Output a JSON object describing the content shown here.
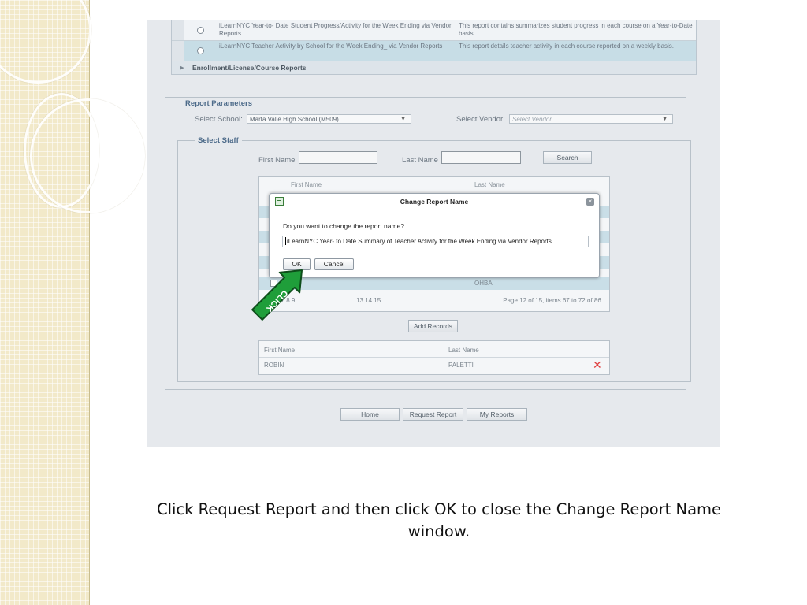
{
  "reports": {
    "rows": [
      {
        "name": "iLearnNYC Year-to- Date Student Progress/Activity for the Week Ending via Vendor Reports",
        "description": "This report contains summarizes student progress in each course on a Year-to-Date basis."
      },
      {
        "name": "iLearnNYC Teacher Activity by School for the Week Ending_ via Vendor Reports",
        "description": "This report details teacher activity in each course reported on a weekly basis."
      }
    ],
    "section": "Enrollment/License/Course Reports"
  },
  "params": {
    "legend": "Report Parameters",
    "school_label": "Select School:",
    "school_value": "Marta Valle High School (M509)",
    "vendor_label": "Select Vendor:",
    "vendor_placeholder": "Select Vendor"
  },
  "staff": {
    "legend": "Select Staff",
    "first_name_label": "First Name",
    "last_name_label": "Last Name",
    "search_label": "Search",
    "grid_first_header": "First Name",
    "grid_last_header": "Last Name",
    "last_row_first": "RO",
    "last_row_last": "OHBA",
    "pager_pages": "... 6  7  8  9",
    "pager_pages_end": "13  14  15",
    "pager_info": "Page 12 of 15, items 67 to 72 of 86.",
    "add_records_label": "Add Records",
    "selected_first_header": "First Name",
    "selected_last_header": "Last Name",
    "selected_first": "ROBIN",
    "selected_last": "PALETTI"
  },
  "footer_buttons": {
    "home": "Home",
    "request_report": "Request Report",
    "my_reports": "My Reports"
  },
  "dialog": {
    "title": "Change Report Name",
    "prompt": "Do you want to change the report name?",
    "value": "iLearnNYC Year- to Date Summary of Teacher Activity for the Week Ending via Vendor Reports",
    "ok": "OK",
    "cancel": "Cancel"
  },
  "annotation": {
    "label": "CLICK",
    "color": "#1f9e3a"
  },
  "caption": "Click Request Report and then click OK to close the Change Report Name window.",
  "colors": {
    "remove_icon": "#e04040",
    "legend_text": "#4d6b8a"
  }
}
